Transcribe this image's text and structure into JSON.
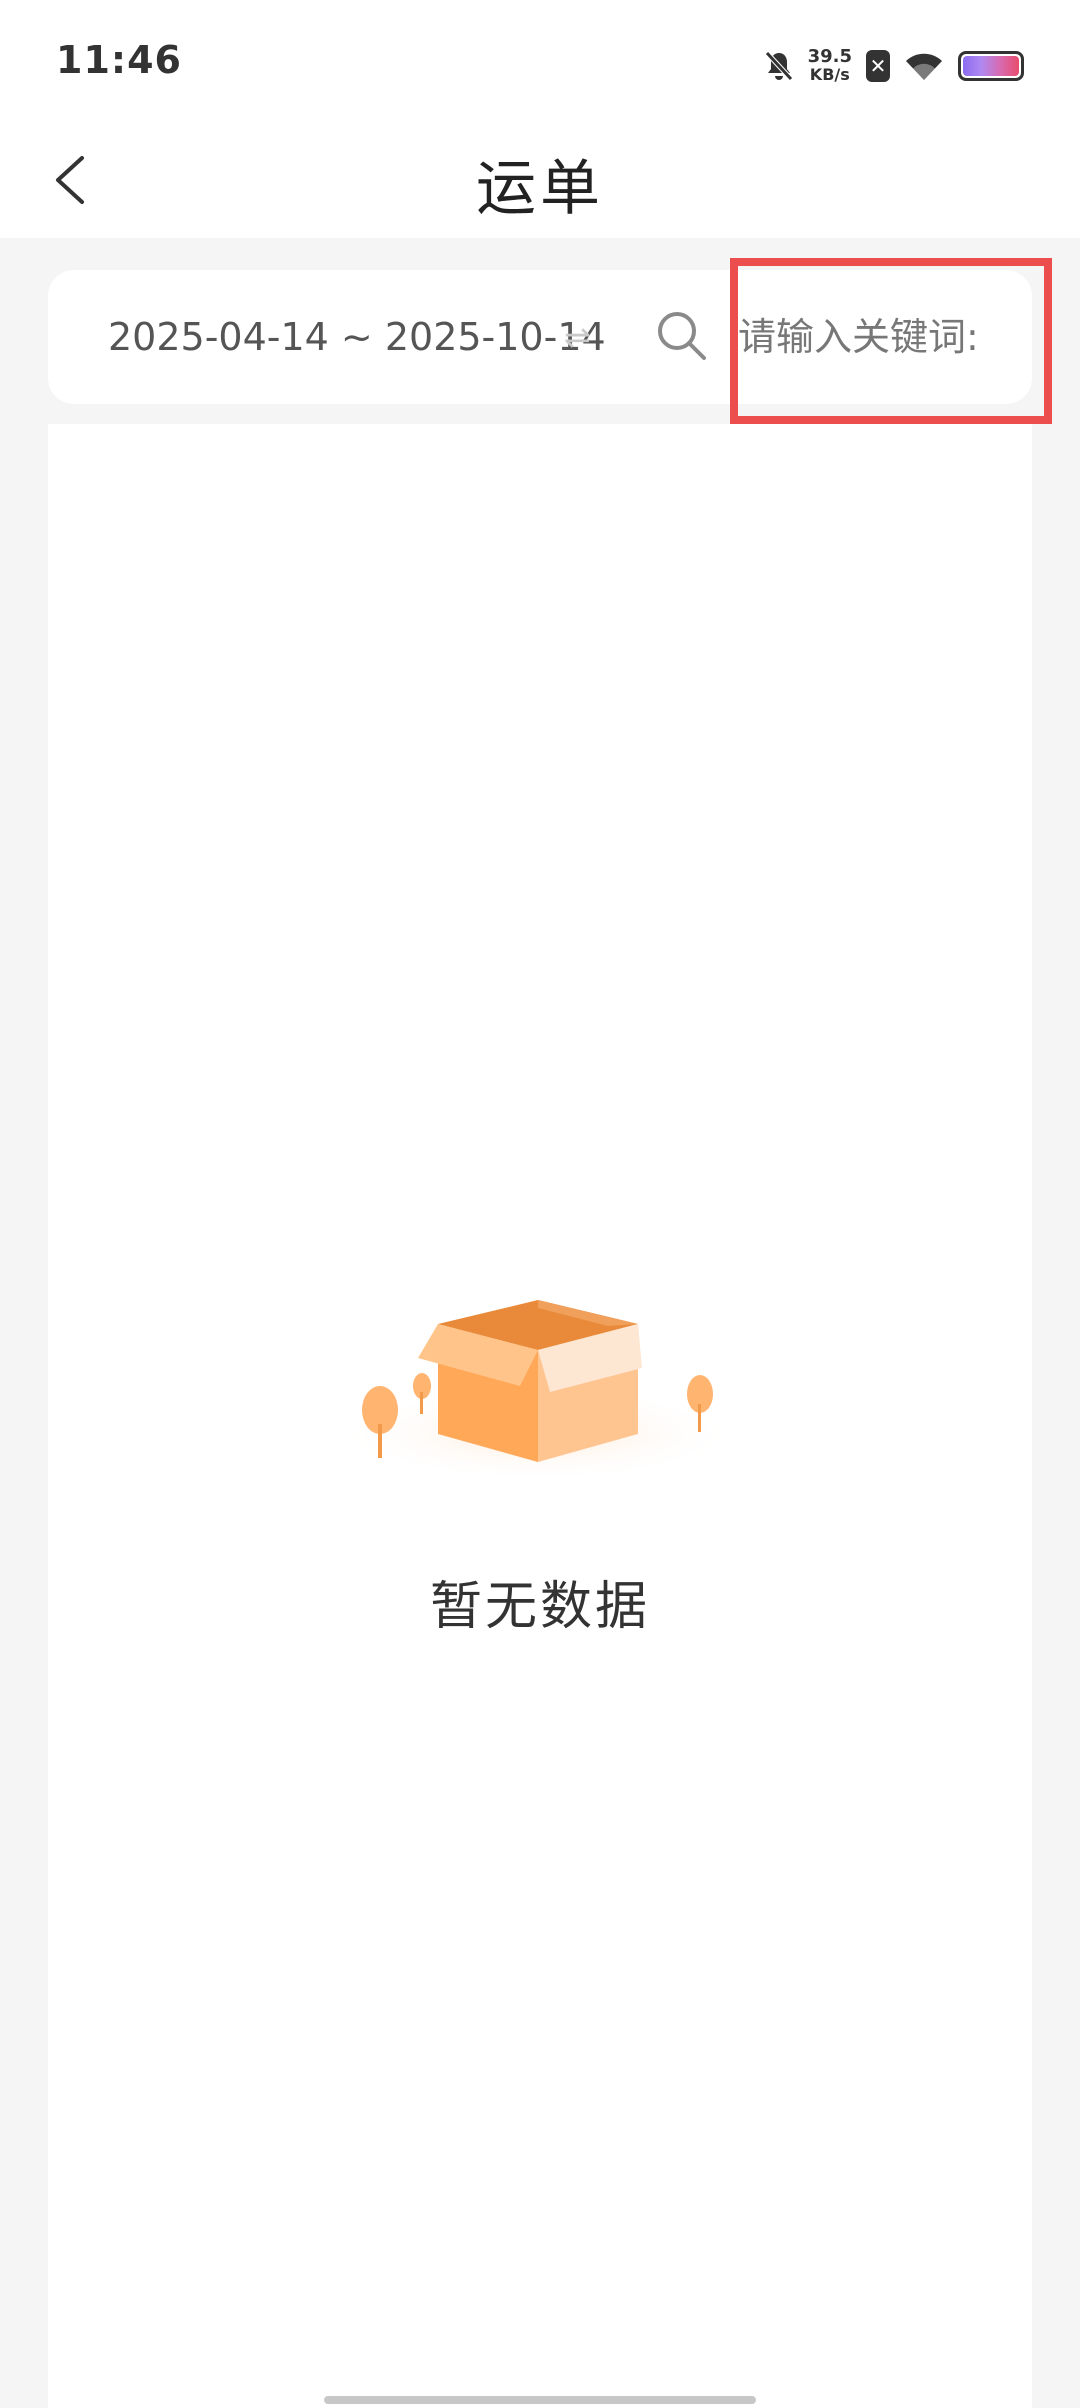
{
  "status_bar": {
    "time": "11:46",
    "net_speed_value": "39.5",
    "net_speed_unit": "KB/s",
    "icons": [
      "mute-bell-icon",
      "sim-x-icon",
      "wifi-icon",
      "battery-icon"
    ]
  },
  "nav": {
    "title": "运单",
    "back_icon": "chevron-left-icon"
  },
  "filter": {
    "date_range": "2025-04-14 ~ 2025-10-14",
    "swap_symbol": "⇌",
    "search_placeholder": "请输入关键词:"
  },
  "empty_state": {
    "illustration": "open-box-icon",
    "text": "暂无数据"
  },
  "colors": {
    "accent_highlight": "#ec4d4d",
    "box_orange": "#ffa85c",
    "background": "#f5f5f5"
  }
}
